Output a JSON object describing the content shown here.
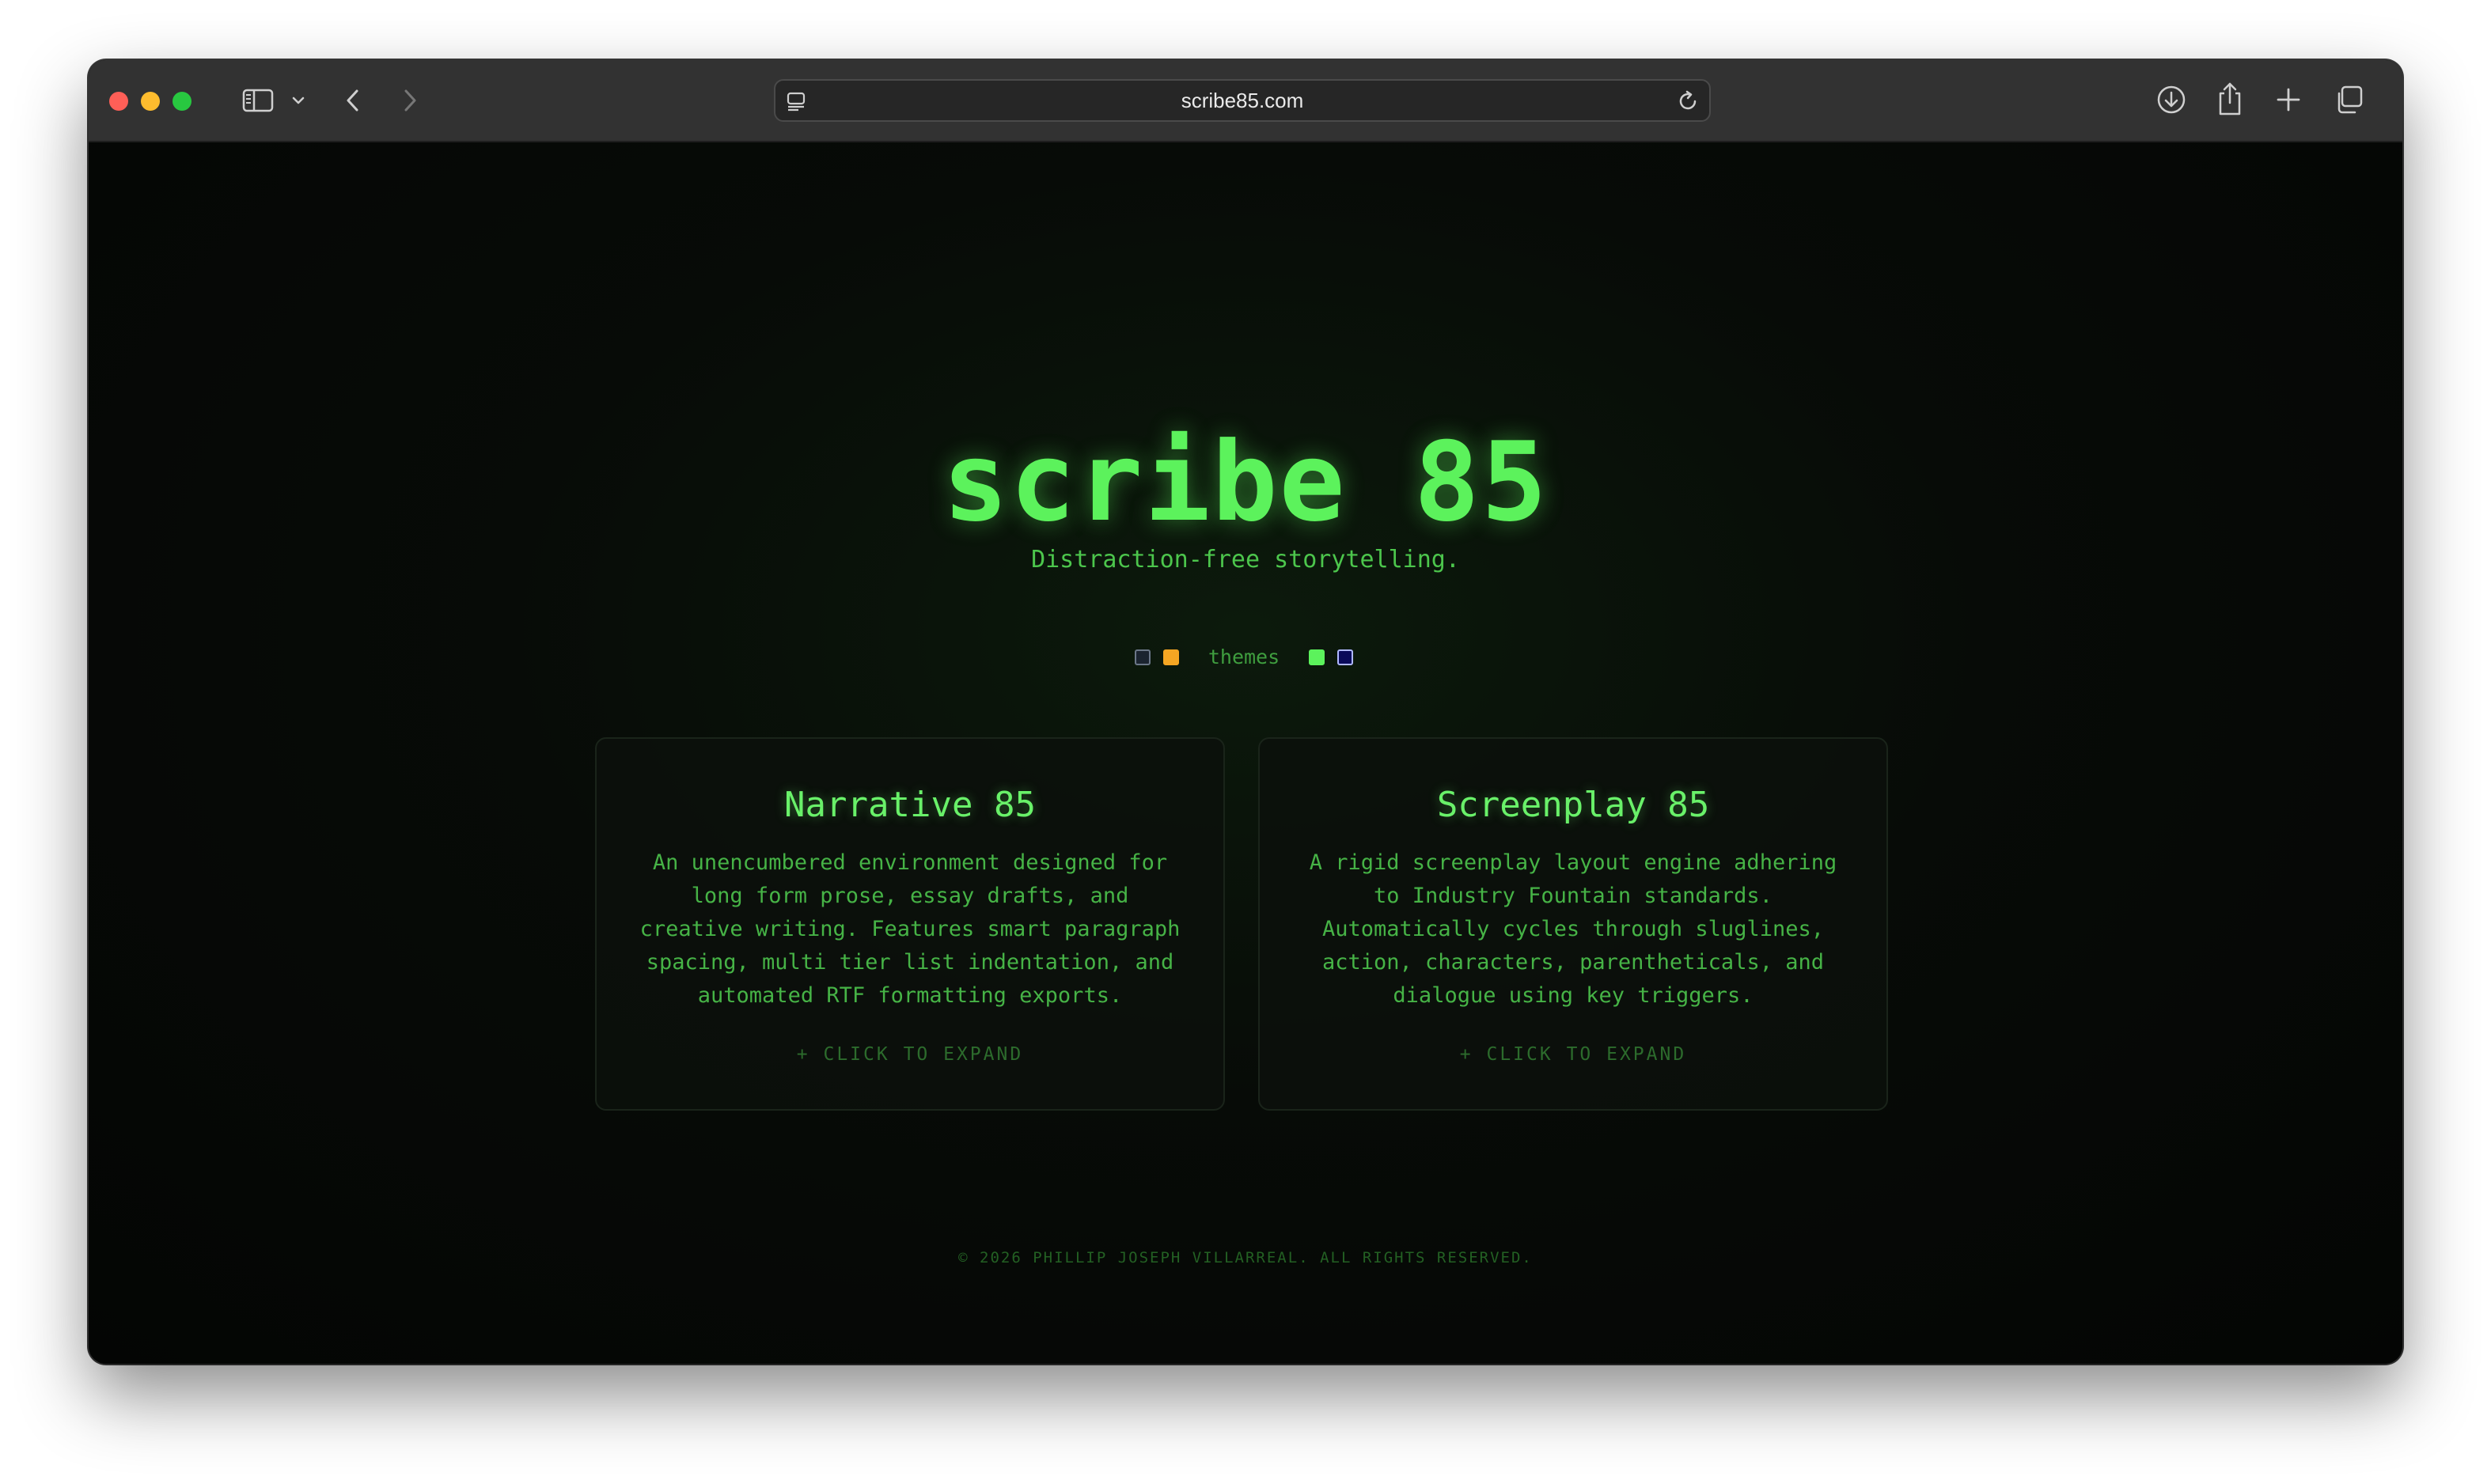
{
  "browser": {
    "url": "scribe85.com",
    "traffic_lights": {
      "close": "#ff5f57",
      "minimize": "#febc2e",
      "zoom": "#28c840"
    },
    "icons": {
      "sidebar": "sidebar-icon",
      "sidebar_menu": "chevron-down-icon",
      "back": "chevron-left-icon",
      "forward": "chevron-right-icon",
      "page_settings": "page-settings-icon",
      "reload": "reload-icon",
      "downloads": "download-icon",
      "share": "share-icon",
      "new_tab": "plus-icon",
      "tab_overview": "tabs-icon"
    }
  },
  "hero": {
    "title": "scribe 85",
    "tagline": "Distraction-free storytelling."
  },
  "themes": {
    "label": "themes",
    "swatches": [
      {
        "name": "slate",
        "color": "#1b2430",
        "border": "#6b7788"
      },
      {
        "name": "amber",
        "color": "#f5a623",
        "border": "#f5a623"
      },
      {
        "name": "green",
        "color": "#5cf25c",
        "border": "#5cf25c"
      },
      {
        "name": "blue",
        "color": "#0a0a5a",
        "border": "#b0b8ff"
      }
    ]
  },
  "cards": [
    {
      "title": "Narrative 85",
      "description": "An unencumbered environment designed for\nlong form prose, essay drafts, and\ncreative writing. Features smart paragraph\nspacing, multi tier list indentation, and\nautomated RTF formatting exports.",
      "expand": "+ CLICK TO EXPAND"
    },
    {
      "title": "Screenplay 85",
      "description": "A rigid screenplay layout engine adhering\nto Industry Fountain standards.\nAutomatically cycles through sluglines,\naction, characters, parentheticals, and\ndialogue using key triggers.",
      "expand": "+ CLICK TO EXPAND"
    }
  ],
  "footer": {
    "text": "© 2026 PHILLIP JOSEPH VILLARREAL. ALL RIGHTS RESERVED."
  },
  "colors": {
    "accent": "#5cf25c",
    "page_background": "#060806"
  }
}
